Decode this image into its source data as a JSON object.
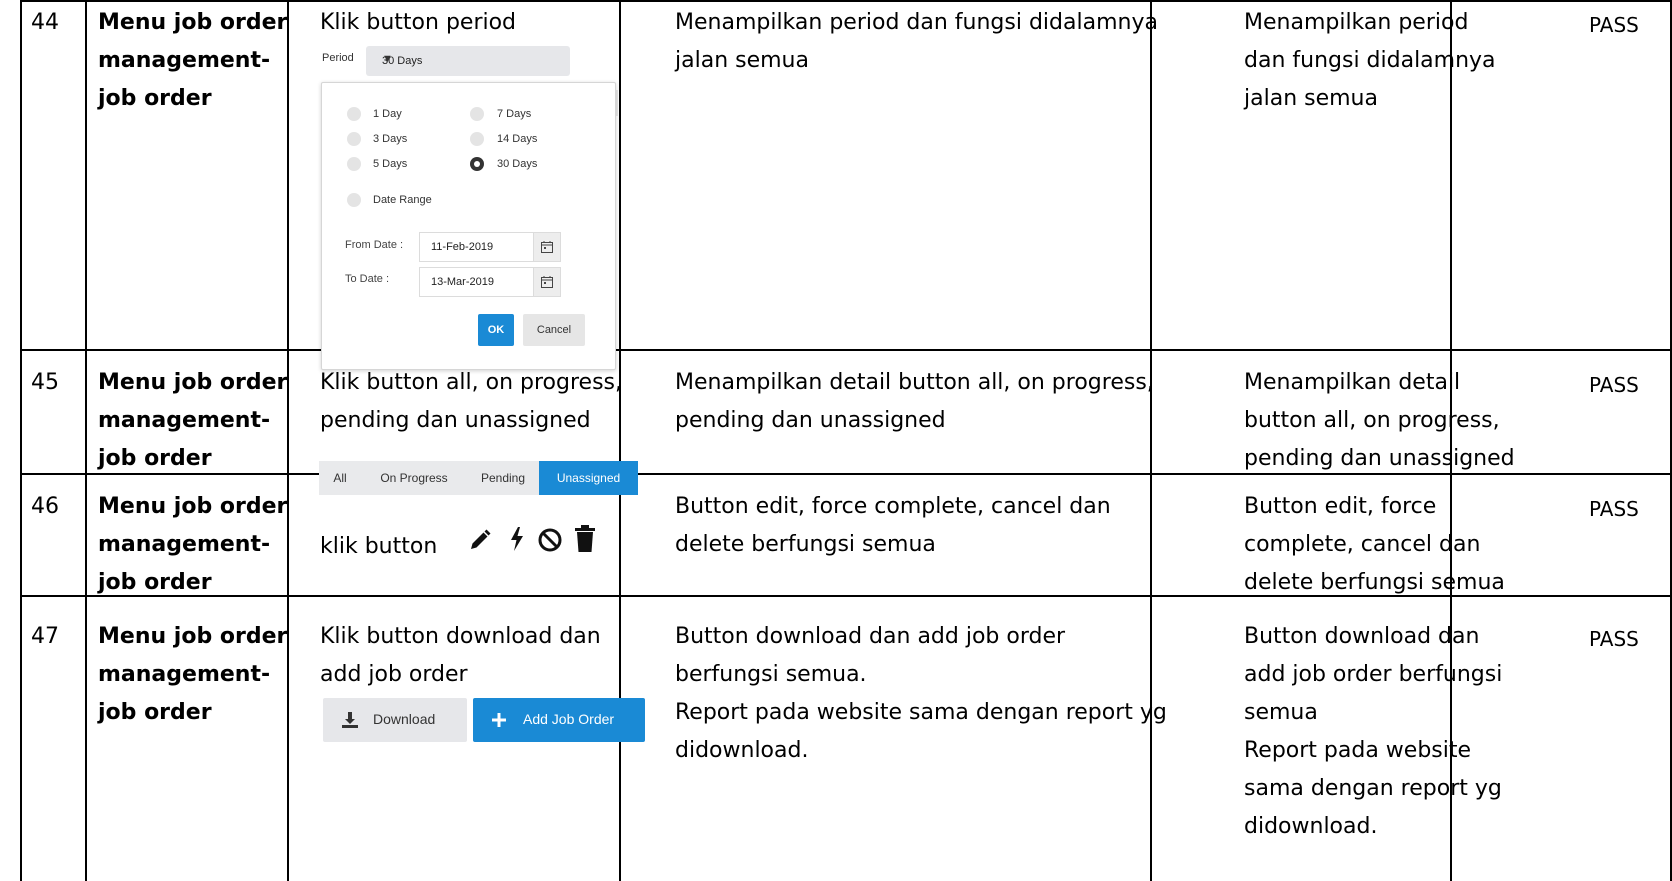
{
  "rows": [
    {
      "no": "44",
      "menu": "Menu job order\nmanagement-\njob order",
      "step": "Klik button period",
      "expected": "Menampilkan period dan fungsi didalamnya\njalan semua",
      "actual": "Menampilkan period\ndan fungsi didalamnya\njalan semua",
      "status": "PASS"
    },
    {
      "no": "45",
      "menu": "Menu job order\nmanagement-\njob order",
      "step": "Klik button all, on progress,\npending dan unassigned",
      "expected": "Menampilkan detail button all, on progress,\npending dan unassigned",
      "actual": "Menampilkan detail\nbutton all, on progress,\npending dan unassigned",
      "status": "PASS"
    },
    {
      "no": "46",
      "menu": "Menu job order\nmanagement-\njob order",
      "step": "klik button",
      "expected": "Button edit, force complete, cancel dan\ndelete berfungsi semua",
      "actual": "Button edit, force\ncomplete, cancel dan\ndelete berfungsi semua",
      "status": "PASS"
    },
    {
      "no": "47",
      "menu": "Menu job order\nmanagement-\njob order",
      "step": "Klik button download dan\nadd job order",
      "expected": "Button download dan add job order\nberfungsi semua.\nReport pada website sama dengan report yg\ndidownload.",
      "actual": "Button download dan\nadd job order berfungsi\nsemua\nReport pada website\nsama dengan report yg\ndidownload.",
      "status": "PASS"
    }
  ],
  "period_widget": {
    "label": "Period",
    "selected": "30 Days",
    "options": [
      "1 Day",
      "7 Days",
      "3 Days",
      "14 Days",
      "5 Days",
      "30 Days"
    ],
    "date_range_label": "Date Range",
    "from_label": "From Date :",
    "from_value": "11-Feb-2019",
    "to_label": "To Date :",
    "to_value": "13-Mar-2019",
    "ok_label": "OK",
    "cancel_label": "Cancel"
  },
  "tabs": [
    "All",
    "On Progress",
    "Pending",
    "Unassigned"
  ],
  "active_tab": "Unassigned",
  "action_icons": [
    "pencil-icon",
    "bolt-icon",
    "ban-icon",
    "trash-icon"
  ],
  "buttons": {
    "download_label": "Download",
    "add_label": "Add Job Order"
  },
  "colors": {
    "accent": "#1a8ad5",
    "neutral": "#e6e7ea"
  }
}
